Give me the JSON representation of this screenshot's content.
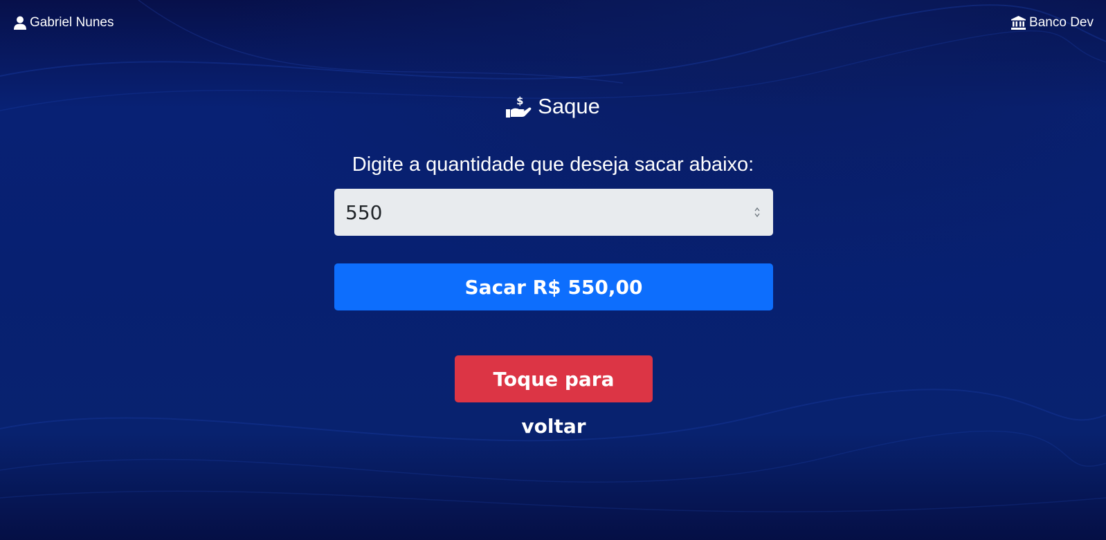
{
  "header": {
    "user_name": "Gabriel Nunes",
    "bank_name": "Banco Dev",
    "user_icon": "user-icon",
    "bank_icon": "bank-icon"
  },
  "main": {
    "title": "Saque",
    "title_icon": "hand-holding-dollar-icon",
    "prompt": "Digite a quantidade que deseja sacar abaixo:",
    "amount_value": "550",
    "withdraw_label": "Sacar R$ 550,00",
    "back_label": "Toque para voltar"
  },
  "colors": {
    "background": "#071f6a",
    "input_bg": "#e8ebee",
    "primary": "#0d6efd",
    "danger": "#dc3545",
    "text": "#ffffff"
  }
}
